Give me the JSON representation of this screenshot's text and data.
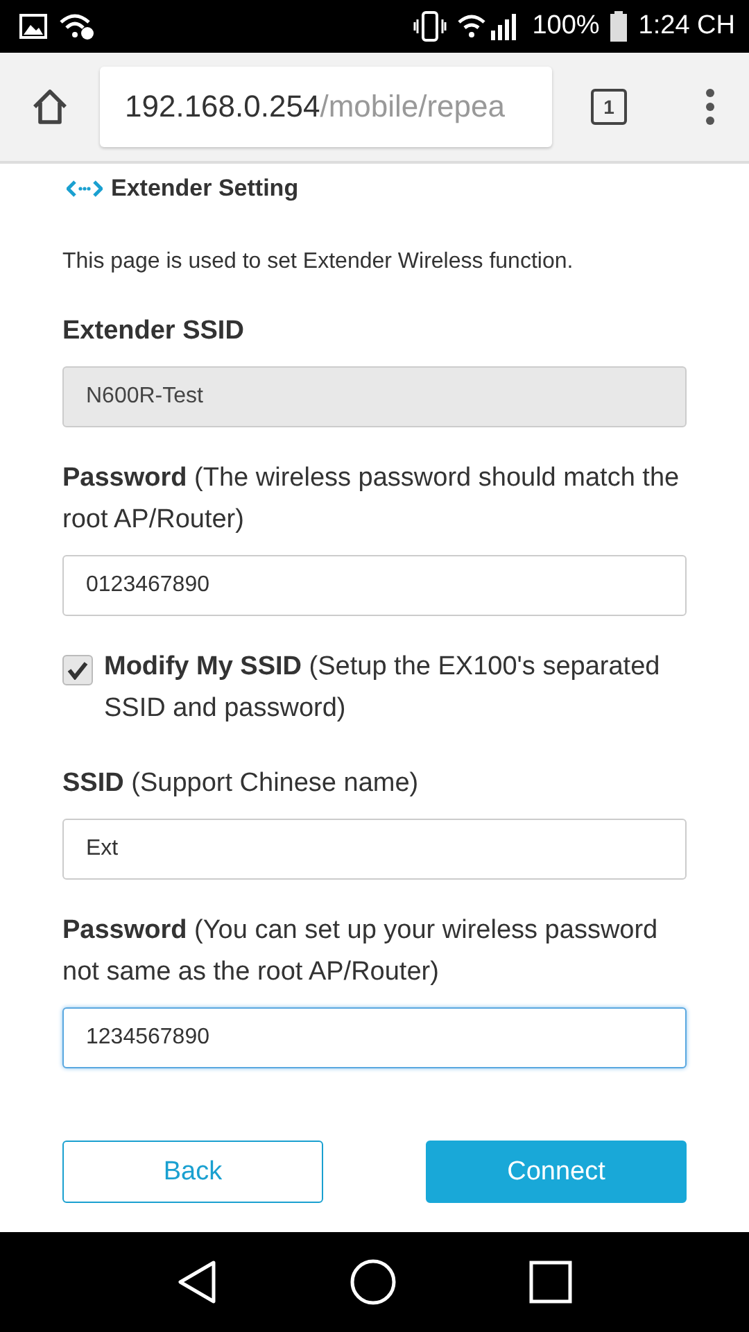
{
  "status_bar": {
    "battery": "100%",
    "time": "1:24 CH"
  },
  "browser": {
    "url_host": "192.168.0.254",
    "url_path": "/mobile/repea",
    "tab_count": "1"
  },
  "header": {
    "title": "Extender Setting"
  },
  "description": "This page is used to set Extender Wireless function.",
  "form": [
    {
      "kind": "field",
      "label": "**Extender SSID**",
      "value": "N600R-Test",
      "disabled": true,
      "focused": false
    },
    {
      "kind": "field",
      "label": "**Password** (The wireless password should match the root AP/Router)",
      "value": "0123467890",
      "disabled": false,
      "focused": false
    },
    {
      "kind": "checkbox",
      "label": "**Modify My SSID** (Setup the EX100's separated SSID and password)",
      "checked": true
    },
    {
      "kind": "field",
      "label": "**SSID** (Support Chinese name)",
      "value": "Ext",
      "disabled": false,
      "focused": false
    },
    {
      "kind": "field",
      "label": "**Password** (You can set up your wireless password not same as the root AP/Router)",
      "value": "1234567890",
      "disabled": false,
      "focused": true
    }
  ],
  "buttons": [
    {
      "label": "Back",
      "primary": false
    },
    {
      "label": "Connect",
      "primary": true
    }
  ]
}
